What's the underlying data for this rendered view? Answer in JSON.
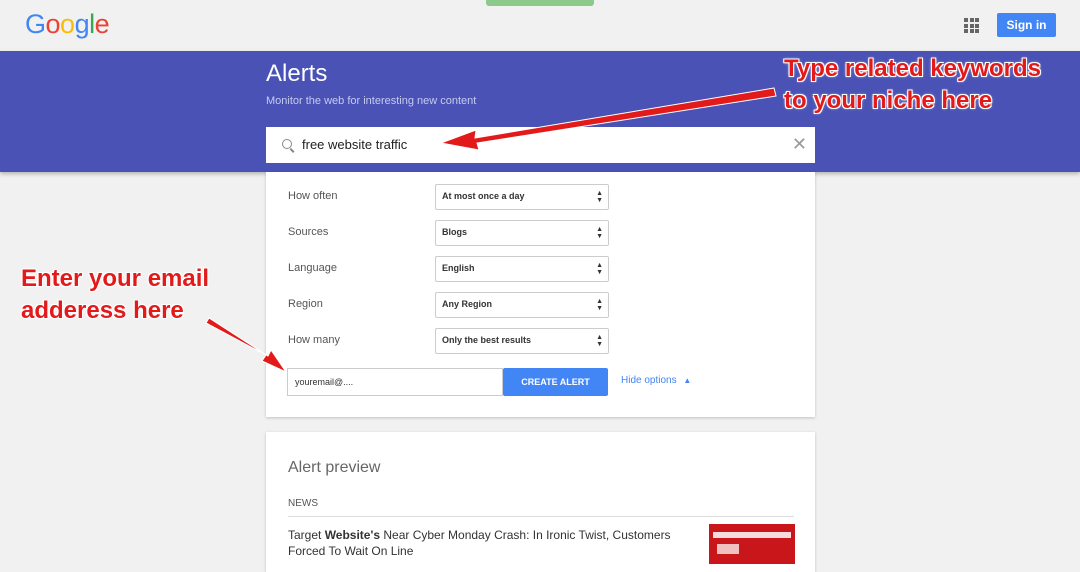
{
  "header": {
    "logo": "Google",
    "signin": "Sign in"
  },
  "banner": {
    "title": "Alerts",
    "subtitle": "Monitor the web for interesting new content"
  },
  "search": {
    "value": "free website traffic"
  },
  "options": [
    {
      "label": "How often",
      "value": "At most once a day"
    },
    {
      "label": "Sources",
      "value": "Blogs"
    },
    {
      "label": "Language",
      "value": "English"
    },
    {
      "label": "Region",
      "value": "Any Region"
    },
    {
      "label": "How many",
      "value": "Only the best results"
    }
  ],
  "email": {
    "value": "youremail@...."
  },
  "create_alert": "CREATE ALERT",
  "hide_options": "Hide options",
  "preview": {
    "title": "Alert preview",
    "section": "NEWS",
    "headline_pre": "Target ",
    "headline_bold": "Website's",
    "headline_post": " Near Cyber Monday Crash: In Ironic Twist, Customers Forced To Wait On Line"
  },
  "annotations": {
    "keywords_1": "Type related keywords",
    "keywords_2": "to your niche here",
    "email_1": "Enter your email",
    "email_2": "adderess here"
  },
  "colors": {
    "banner": "#4a53b5",
    "accent": "#4285f4",
    "annotation": "#e21a1a"
  }
}
